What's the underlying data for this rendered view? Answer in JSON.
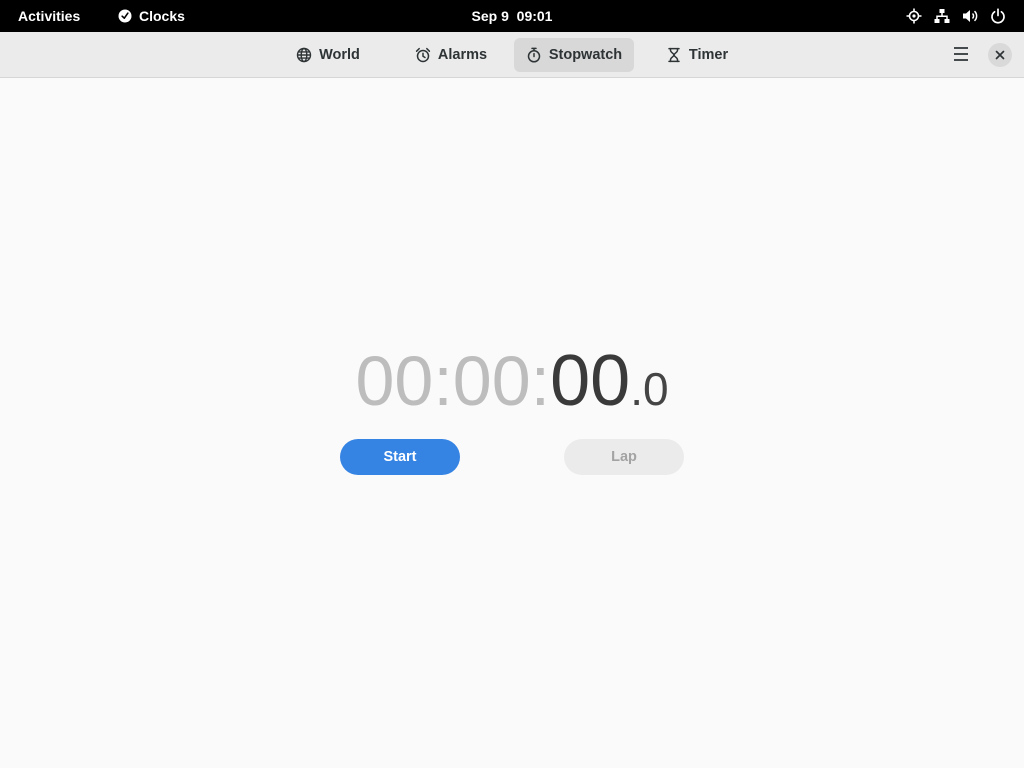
{
  "top_bar": {
    "activities_label": "Activities",
    "app_menu": {
      "icon": "clocks-app-icon",
      "label": "Clocks"
    },
    "datetime": "Sep 9  09:01",
    "status_icons": [
      "location-icon",
      "network-icon",
      "volume-icon",
      "power-icon"
    ]
  },
  "header_bar": {
    "tabs": [
      {
        "label": "World",
        "icon": "globe-icon",
        "selected": false
      },
      {
        "label": "Alarms",
        "icon": "alarm-icon",
        "selected": false
      },
      {
        "label": "Stopwatch",
        "icon": "stopwatch-icon",
        "selected": true
      },
      {
        "label": "Timer",
        "icon": "hourglass-icon",
        "selected": false
      }
    ],
    "menu_icon": "hamburger-menu-icon",
    "close_icon": "close-icon"
  },
  "stopwatch": {
    "hours": "00",
    "minutes": "00",
    "seconds": "00",
    "tenths": "0",
    "time_separator": ":",
    "decimal_separator": "."
  },
  "controls": {
    "start_label": "Start",
    "lap_label": "Lap",
    "lap_enabled": false
  },
  "colors": {
    "top_bar_bg": "#000000",
    "header_bg": "#ebebeb",
    "content_bg": "#fafafa",
    "accent": "#3584e4",
    "selected_tab_bg": "#d8d8d8",
    "inactive_digits": "#bdbdbd",
    "active_digits": "#3a3a3a"
  }
}
